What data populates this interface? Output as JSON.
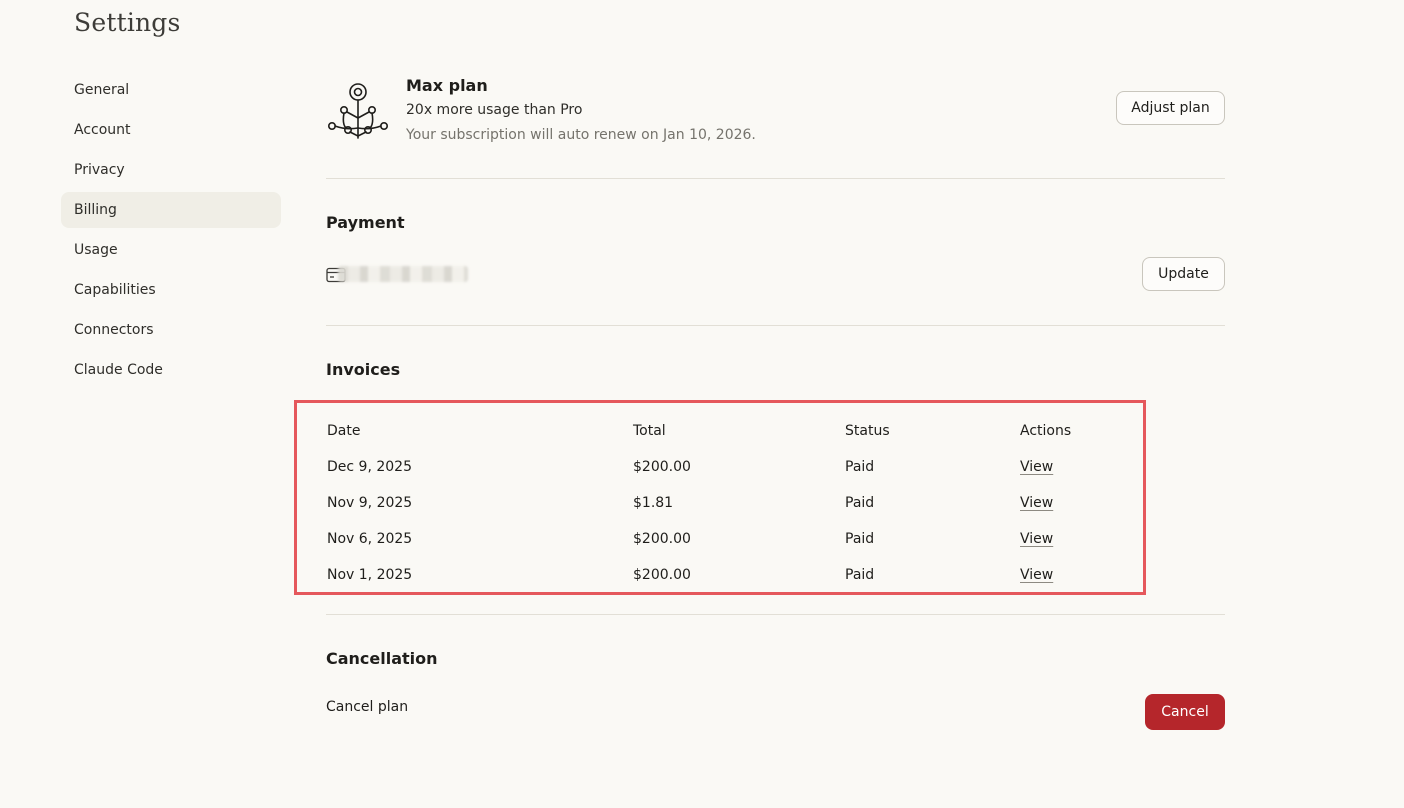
{
  "header": {
    "title": "Settings"
  },
  "sidebar": {
    "items": [
      {
        "label": "General"
      },
      {
        "label": "Account"
      },
      {
        "label": "Privacy"
      },
      {
        "label": "Billing"
      },
      {
        "label": "Usage"
      },
      {
        "label": "Capabilities"
      },
      {
        "label": "Connectors"
      },
      {
        "label": "Claude Code"
      }
    ],
    "active": "Billing"
  },
  "plan": {
    "icon": "plant-network-icon",
    "name": "Max plan",
    "description": "20x more usage than Pro",
    "renewal": "Your subscription will auto renew on Jan 10, 2026.",
    "adjust_label": "Adjust plan"
  },
  "payment": {
    "title": "Payment",
    "card_icon": "credit-card-icon",
    "update_label": "Update"
  },
  "invoices": {
    "title": "Invoices",
    "columns": [
      "Date",
      "Total",
      "Status",
      "Actions"
    ],
    "rows": [
      {
        "date": "Dec 9, 2025",
        "total": "$200.00",
        "status": "Paid",
        "action": "View"
      },
      {
        "date": "Nov 9, 2025",
        "total": "$1.81",
        "status": "Paid",
        "action": "View"
      },
      {
        "date": "Nov 6, 2025",
        "total": "$200.00",
        "status": "Paid",
        "action": "View"
      },
      {
        "date": "Nov 1, 2025",
        "total": "$200.00",
        "status": "Paid",
        "action": "View"
      }
    ]
  },
  "cancellation": {
    "title": "Cancellation",
    "label": "Cancel plan",
    "button_label": "Cancel"
  },
  "colors": {
    "background": "#faf9f5",
    "cancel_button": "#b5262b",
    "highlight_box": "#e5585c"
  }
}
